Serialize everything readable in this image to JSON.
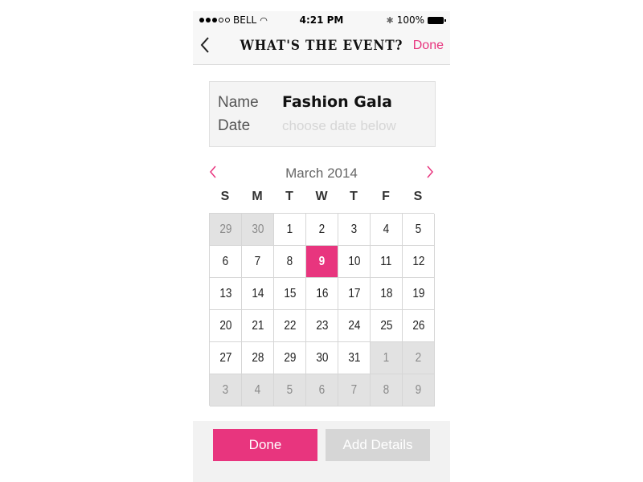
{
  "status_bar": {
    "carrier": "BELL",
    "time": "4:21 PM",
    "battery": "100%",
    "icons": [
      "signal-dots-icon",
      "wifi-icon",
      "bluetooth-icon",
      "battery-icon"
    ]
  },
  "nav": {
    "back_icon": "chevron-left-icon",
    "title": "WHAT'S THE EVENT?",
    "done_label": "Done"
  },
  "event": {
    "name_label": "Name",
    "name_value": "Fashion Gala",
    "date_label": "Date",
    "date_placeholder": "choose date below"
  },
  "calendar": {
    "month": "March 2014",
    "prev_icon": "chevron-left-icon",
    "next_icon": "chevron-right-icon",
    "weekdays": [
      "S",
      "M",
      "T",
      "W",
      "T",
      "F",
      "S"
    ],
    "days": [
      {
        "d": "29",
        "other": true
      },
      {
        "d": "30",
        "other": true
      },
      {
        "d": "1"
      },
      {
        "d": "2"
      },
      {
        "d": "3"
      },
      {
        "d": "4"
      },
      {
        "d": "5"
      },
      {
        "d": "6"
      },
      {
        "d": "7"
      },
      {
        "d": "8"
      },
      {
        "d": "9",
        "selected": true
      },
      {
        "d": "10"
      },
      {
        "d": "11"
      },
      {
        "d": "12"
      },
      {
        "d": "13"
      },
      {
        "d": "14"
      },
      {
        "d": "15"
      },
      {
        "d": "16"
      },
      {
        "d": "17"
      },
      {
        "d": "18"
      },
      {
        "d": "19"
      },
      {
        "d": "20"
      },
      {
        "d": "21"
      },
      {
        "d": "22"
      },
      {
        "d": "23"
      },
      {
        "d": "24"
      },
      {
        "d": "25"
      },
      {
        "d": "26"
      },
      {
        "d": "27"
      },
      {
        "d": "28"
      },
      {
        "d": "29"
      },
      {
        "d": "30"
      },
      {
        "d": "31"
      },
      {
        "d": "1",
        "other": true
      },
      {
        "d": "2",
        "other": true
      },
      {
        "d": "3",
        "other": true
      },
      {
        "d": "4",
        "other": true
      },
      {
        "d": "5",
        "other": true
      },
      {
        "d": "6",
        "other": true
      },
      {
        "d": "7",
        "other": true
      },
      {
        "d": "8",
        "other": true
      },
      {
        "d": "9",
        "other": true
      }
    ]
  },
  "actions": {
    "done_label": "Done",
    "add_details_label": "Add Details"
  },
  "colors": {
    "accent": "#e8357e",
    "muted_cell": "#e2e2e2",
    "disabled_button": "#d6d6d6"
  }
}
